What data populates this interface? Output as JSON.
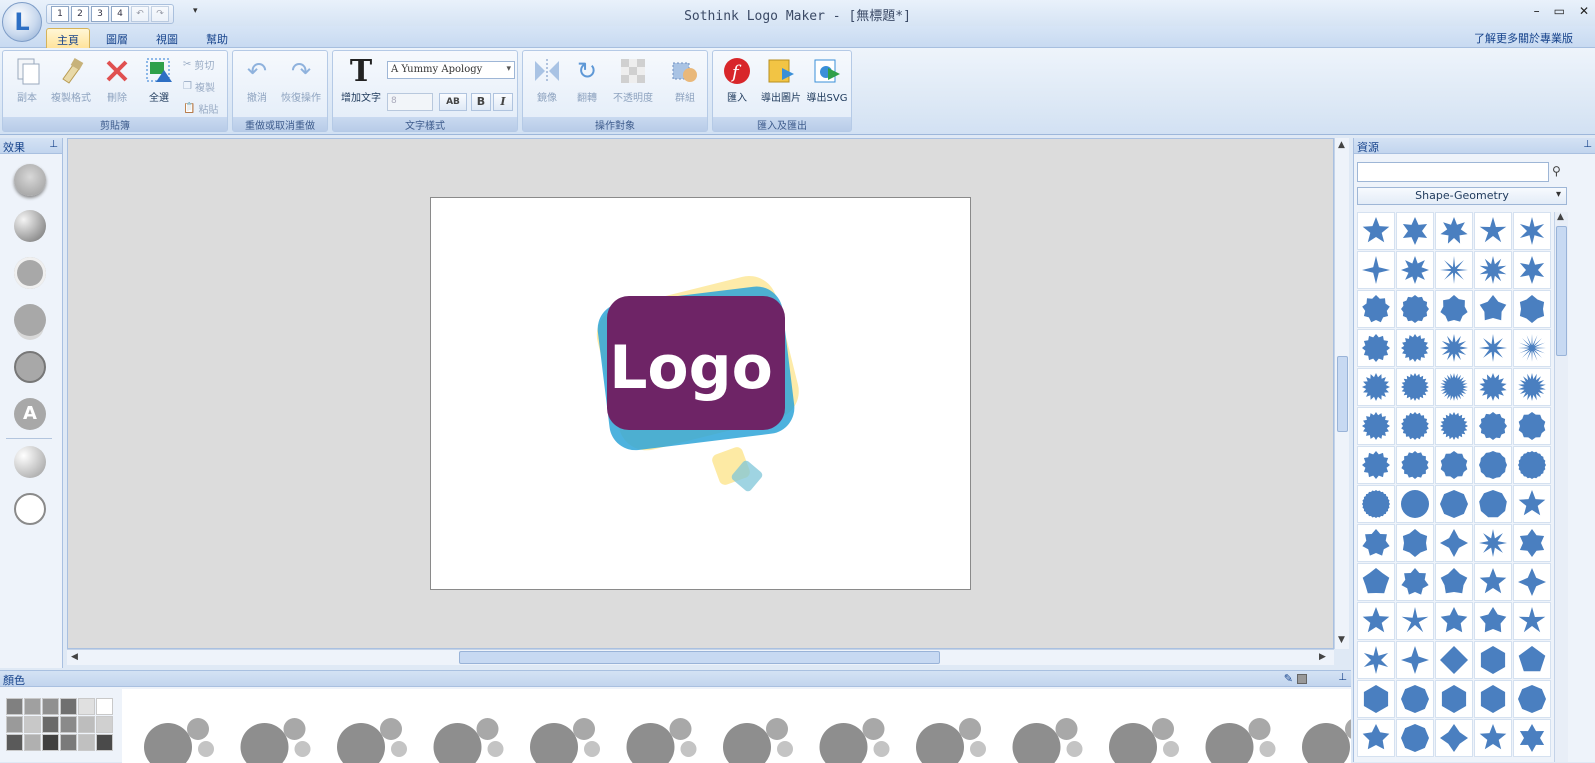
{
  "window": {
    "title": "Sothink Logo Maker - [無標題*]",
    "controls": [
      "–",
      "▭",
      "✕"
    ]
  },
  "quick_access": [
    "1",
    "2",
    "3",
    "4"
  ],
  "tabs": [
    {
      "label": "主頁",
      "active": true
    },
    {
      "label": "圖層",
      "active": false
    },
    {
      "label": "視圖",
      "active": false
    },
    {
      "label": "幫助",
      "active": false
    }
  ],
  "tabs_right_link": "了解更多關於專業版",
  "ribbon": {
    "clipboard": {
      "label": "剪貼簿",
      "copy_label": "副本",
      "format_painter_label": "複製格式",
      "delete_label": "刪除",
      "select_all_label": "全選",
      "cut_label": "剪切",
      "duplicate_label": "複製",
      "paste_label": "粘貼"
    },
    "undo_redo": {
      "label": "重做或取消重做",
      "undo_label": "撤消",
      "redo_label": "恢復操作"
    },
    "text_style": {
      "label": "文字樣式",
      "add_text_label": "增加文字",
      "font_value": "A Yummy Apology",
      "size_value": "8"
    },
    "operate": {
      "label": "操作對象",
      "mirror_label": "鏡像",
      "rotate_label": "翻轉",
      "opacity_label": "不透明度",
      "group_label": "群組"
    },
    "import_export": {
      "label": "匯入及匯出",
      "import_label": "匯入",
      "export_image_label": "導出圖片",
      "export_svg_label": "導出SVG"
    }
  },
  "effects_panel": {
    "title": "效果"
  },
  "canvas": {
    "logo_text": "Logo"
  },
  "resources_panel": {
    "title": "資源",
    "search_placeholder": "",
    "category": "Shape-Geometry"
  },
  "colors_panel": {
    "title": "顏色"
  },
  "colors": {
    "accent": "#2d6fc4",
    "shape_fill": "#4a7fc0",
    "logo_purple": "#6e2466",
    "logo_blue": "#2ea4d8",
    "logo_yellow": "#fde89a"
  }
}
